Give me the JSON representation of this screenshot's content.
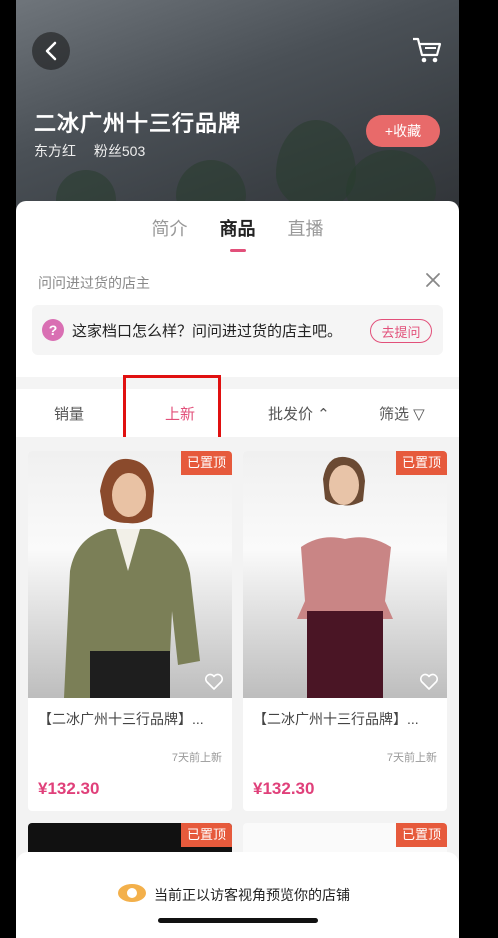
{
  "header": {
    "shop_name": "二冰广州十三行品牌",
    "location": "东方红",
    "fans": "粉丝503",
    "favorite_label": "+收藏"
  },
  "tabs": [
    {
      "label": "简介"
    },
    {
      "label": "商品",
      "active": true
    },
    {
      "label": "直播"
    }
  ],
  "ask": {
    "title": "问问进过货的店主",
    "prompt": "这家档口怎么样？问问进过货的店主吧。",
    "button": "去提问"
  },
  "sort": {
    "sales": "销量",
    "new": "上新",
    "price": "批发价 ⌃",
    "filter": "筛选 ▽"
  },
  "products": [
    {
      "badge": "已置顶",
      "name": "【二冰广州十三行品牌】...",
      "time": "7天前上新",
      "price": "¥132.30"
    },
    {
      "badge": "已置顶",
      "name": "【二冰广州十三行品牌】...",
      "time": "7天前上新",
      "price": "¥132.30"
    },
    {
      "badge": "已置顶"
    },
    {
      "badge": "已置顶"
    }
  ],
  "footer": {
    "visitor_text": "当前正以访客视角预览你的店铺"
  },
  "colors": {
    "accent": "#e2507a",
    "badge": "#e65a3c",
    "price": "#e0407a",
    "favorite": "#e86a6a",
    "highlight": "#e01010"
  }
}
